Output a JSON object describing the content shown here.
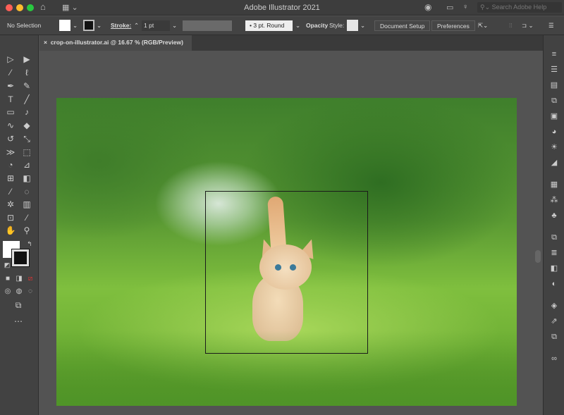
{
  "app": {
    "title": "Adobe Illustrator 2021",
    "search_placeholder": "Search Adobe Help"
  },
  "control": {
    "selection": "No Selection",
    "stroke_label": "Stroke:",
    "stroke_value": "1 pt",
    "brush": "3 pt. Round",
    "opacity_label": "Opacity",
    "style_label": "Style:",
    "document_setup": "Document Setup",
    "preferences": "Preferences"
  },
  "document": {
    "tab_title": "crop-on-illustrator.ai @ 16.67 % (RGB/Preview)",
    "close": "×"
  },
  "colors": {
    "close": "#fe5f57",
    "minimize": "#febc2e",
    "zoom": "#28c840",
    "canvas": "#535353"
  }
}
